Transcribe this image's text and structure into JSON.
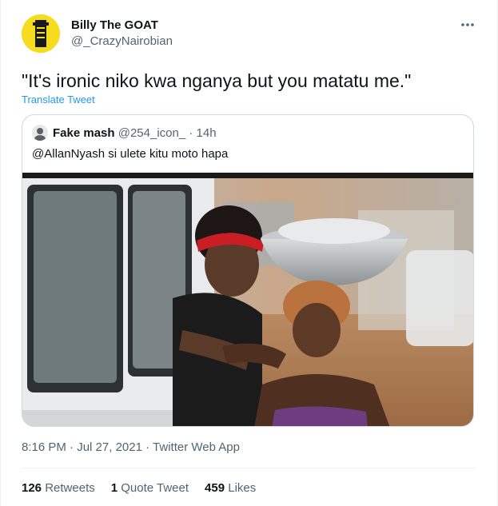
{
  "author": {
    "display_name": "Billy The GOAT",
    "handle": "@_CrazyNairobian",
    "avatar_icon": "avatar-icon"
  },
  "more_icon": "more-horizontal-icon",
  "tweet": {
    "text": "\"It's ironic niko kwa nganya but you matatu me.\"",
    "translate_label": "Translate Tweet"
  },
  "quoted": {
    "display_name": "Fake mash",
    "handle": "@254_icon_",
    "separator": "·",
    "age": "14h",
    "text": "@AllanNyash si ulete kitu moto hapa"
  },
  "meta": {
    "time": "8:16 PM",
    "separator1": "·",
    "date": "Jul 27, 2021",
    "separator2": "·",
    "source": "Twitter Web App"
  },
  "stats": {
    "retweets_count": "126",
    "retweets_label": "Retweets",
    "quotes_count": "1",
    "quotes_label": "Quote Tweet",
    "likes_count": "459",
    "likes_label": "Likes"
  },
  "colors": {
    "link": "#1d9bf0",
    "secondary_text": "#536471",
    "primary_text": "#0f1419",
    "border": "#cfd9de"
  }
}
